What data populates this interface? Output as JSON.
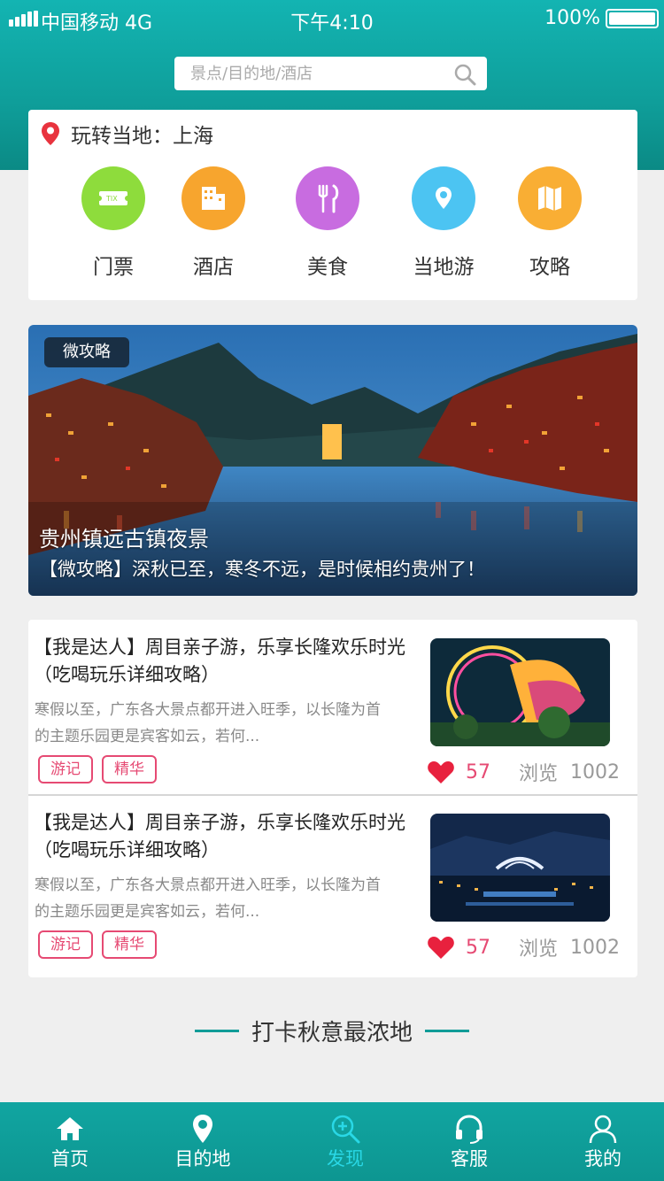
{
  "status_bar": {
    "carrier": "中国移动 4G",
    "time": "下午4:10",
    "battery": "100%"
  },
  "search": {
    "placeholder": "景点/目的地/酒店"
  },
  "location": {
    "text": "玩转当地：上海"
  },
  "categories": [
    {
      "label": "门票",
      "icon": "ticket-icon",
      "color": "#8edc3c"
    },
    {
      "label": "酒店",
      "icon": "hotel-icon",
      "color": "#f7a52e"
    },
    {
      "label": "美食",
      "icon": "food-icon",
      "color": "#c86ce0"
    },
    {
      "label": "当地游",
      "icon": "location-icon",
      "color": "#4cc4f2"
    },
    {
      "label": "攻略",
      "icon": "map-guide-icon",
      "color": "#f9ae34"
    }
  ],
  "banner": {
    "tag": "微攻略",
    "title": "贵州镇远古镇夜景",
    "subtitle": "【微攻略】深秋已至，寒冬不远，是时候相约贵州了！"
  },
  "articles": [
    {
      "title": "【我是达人】周目亲子游，乐享长隆欢乐时光（吃喝玩乐详细攻略）",
      "desc": "寒假以至，广东各大景点都开进入旺季，以长隆为首的主题乐园更是宾客如云，若何...",
      "tags": [
        "游记",
        "精华"
      ],
      "likes": "57",
      "views_label": "浏览",
      "views": "1002"
    },
    {
      "title": "【我是达人】周目亲子游，乐享长隆欢乐时光（吃喝玩乐详细攻略）",
      "desc": "寒假以至，广东各大景点都开进入旺季，以长隆为首的主题乐园更是宾客如云，若何...",
      "tags": [
        "游记",
        "精华"
      ],
      "likes": "57",
      "views_label": "浏览",
      "views": "1002"
    }
  ],
  "section": {
    "heading": "打卡秋意最浓地"
  },
  "tabs": [
    {
      "label": "首页",
      "icon": "home-icon"
    },
    {
      "label": "目的地",
      "icon": "destination-pin-icon"
    },
    {
      "label": "发现",
      "icon": "discover-search-icon",
      "active": true
    },
    {
      "label": "客服",
      "icon": "headset-icon"
    },
    {
      "label": "我的",
      "icon": "user-icon"
    }
  ],
  "colors": {
    "primary": "#119c98",
    "accent_pink": "#e64a73",
    "active_tab": "#29d8e6"
  }
}
